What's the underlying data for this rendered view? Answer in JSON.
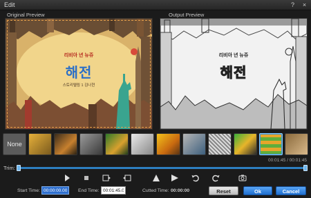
{
  "window": {
    "title": "Edit",
    "buttons": [
      "?",
      "×"
    ]
  },
  "preview": {
    "original_label": "Original Preview",
    "output_label": "Output Preview",
    "poster": {
      "tagline": "리비아 년 뉴쥬",
      "title": "해전",
      "credit": "스토리텔링 1 김나현"
    }
  },
  "filters": {
    "none_label": "None",
    "selected_index": 10,
    "items": [
      {
        "icon": "filter-thumb-warm"
      },
      {
        "icon": "filter-thumb-dark"
      },
      {
        "icon": "filter-thumb-gray"
      },
      {
        "icon": "filter-thumb-green"
      },
      {
        "icon": "filter-thumb-sketch"
      },
      {
        "icon": "filter-thumb-vivid"
      },
      {
        "icon": "filter-thumb-cool"
      },
      {
        "icon": "filter-thumb-engrave"
      },
      {
        "icon": "filter-thumb-color"
      },
      {
        "icon": "filter-thumb-mosaic"
      },
      {
        "icon": "filter-thumb-sepia"
      }
    ]
  },
  "playback": {
    "time_readout": "00:01:45 / 00:01:45"
  },
  "trim": {
    "label": "Trim:"
  },
  "bottom": {
    "start_label": "Start Time:",
    "start_value": "00:00:00.00",
    "end_label": "End Time:",
    "end_value": "00:01:45.00",
    "cut_label": "Cutted Time:",
    "cut_value": "00:00:00",
    "reset_label": "Reset",
    "ok_label": "Ok",
    "cancel_label": "Cancel"
  },
  "colors": {
    "accent": "#2d7fc1",
    "crop_border": "#e8a14b",
    "background": "#1b1b1b"
  }
}
